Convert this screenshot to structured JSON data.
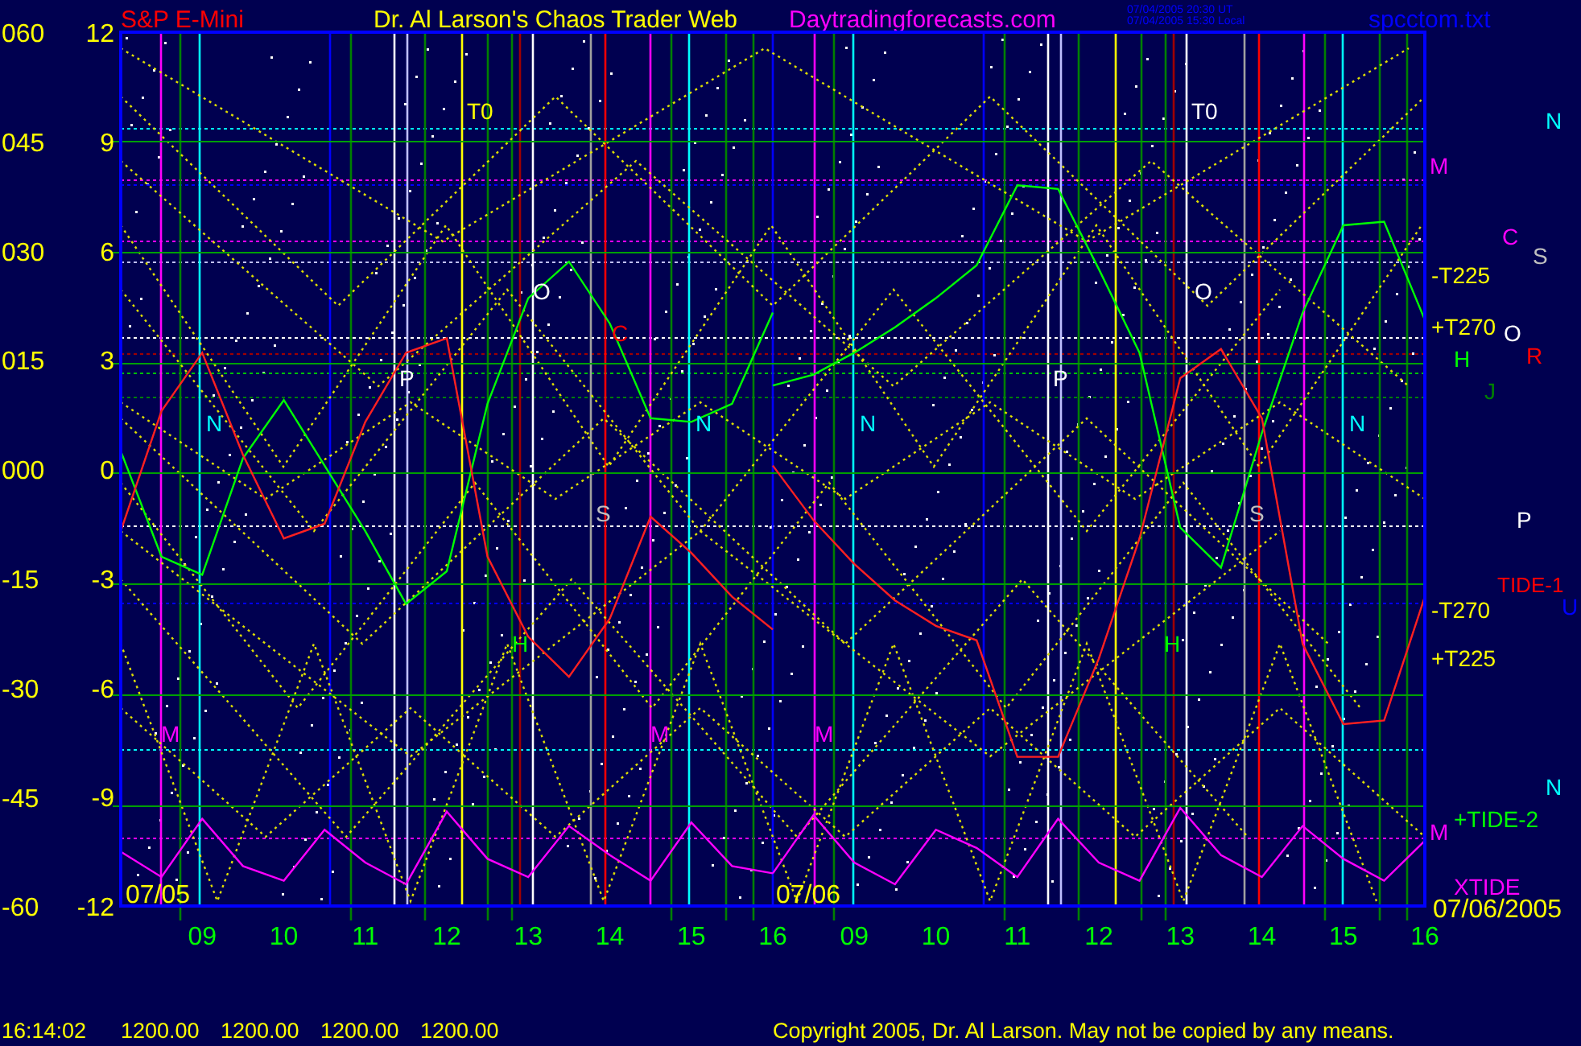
{
  "header": {
    "market": "S&P E-Mini",
    "site_name": "Dr. Al Larson's Chaos Trader Web",
    "url": "Daytradingforecasts.com",
    "timestamps": [
      "07/04/2005 20:30 UT",
      "07/04/2005 15:30 Local"
    ],
    "file": "spcctom.txt"
  },
  "axis_outer": [
    "060",
    "045",
    "030",
    "015",
    "000",
    "-15",
    "-30",
    "-45",
    "-60"
  ],
  "days": [
    {
      "date": "07/05",
      "chart_data": {
        "type": "line",
        "x": [
          8,
          8.5,
          9,
          9.5,
          10,
          10.5,
          11,
          11.5,
          12,
          12.5,
          13,
          13.5,
          14,
          14.5,
          15,
          15.5,
          16
        ],
        "series": [
          {
            "color": "#00ff00",
            "values": [
              0.5,
              -2.4,
              -2.9,
              0.3,
              1.9,
              0.1,
              -1.7,
              -3.7,
              -2.8,
              1.8,
              4.7,
              5.7,
              4.0,
              1.4,
              1.3,
              1.8,
              4.3
            ]
          },
          {
            "color": "#ff2020",
            "values": [
              -1.7,
              1.6,
              3.2,
              0.4,
              -1.9,
              -1.5,
              1.3,
              3.2,
              3.6,
              -2.4,
              -4.6,
              -5.7,
              -4.1,
              -1.3,
              -2.3,
              -3.5,
              -4.4
            ]
          },
          {
            "color": "#ff00ff",
            "values": [
              -10.5,
              -11.2,
              -9.6,
              -10.9,
              -11.3,
              -9.9,
              -10.8,
              -11.4,
              -9.4,
              -10.7,
              -11.2,
              -9.8,
              -10.6,
              -11.3,
              -9.7,
              -10.9,
              -11.1
            ]
          }
        ],
        "xlim": [
          8,
          16
        ],
        "ylim": [
          -12,
          12
        ],
        "xticks": [
          {
            "value": 9,
            "label": "09"
          },
          {
            "value": 10,
            "label": "10"
          },
          {
            "value": 11,
            "label": "11"
          },
          {
            "value": 12,
            "label": "12"
          },
          {
            "value": 13,
            "label": "13"
          },
          {
            "value": 14,
            "label": "14"
          },
          {
            "value": 15,
            "label": "15"
          },
          {
            "value": 16,
            "label": "16"
          }
        ],
        "yticks": [
          12,
          9,
          6,
          3,
          0,
          -3,
          -6,
          -9,
          -12
        ],
        "grid": true
      }
    },
    {
      "date": "07/06",
      "chart_data": {
        "type": "line",
        "x": [
          8,
          8.5,
          9,
          9.5,
          10,
          10.5,
          11,
          11.5,
          12,
          12.5,
          13,
          13.5,
          14,
          14.5,
          15,
          15.5,
          16
        ],
        "series": [
          {
            "color": "#00ff00",
            "values": [
              2.3,
              2.6,
              3.2,
              3.9,
              4.7,
              5.6,
              7.8,
              7.7,
              5.5,
              3.2,
              -1.6,
              -2.7,
              1.0,
              4.3,
              6.7,
              6.8,
              4.1
            ]
          },
          {
            "color": "#ff2020",
            "values": [
              0.1,
              -1.4,
              -2.6,
              -3.6,
              -4.3,
              -4.7,
              -7.9,
              -7.9,
              -5.2,
              -1.9,
              2.5,
              3.3,
              1.4,
              -4.8,
              -7.0,
              -6.9,
              -3.5
            ]
          },
          {
            "color": "#ff00ff",
            "values": [
              -11.1,
              -9.5,
              -10.8,
              -11.4,
              -9.9,
              -10.4,
              -11.2,
              -9.6,
              -10.8,
              -11.3,
              -9.3,
              -10.6,
              -11.2,
              -9.8,
              -10.7,
              -11.3,
              -10.2
            ]
          }
        ],
        "xlim": [
          8,
          16
        ],
        "ylim": [
          -12,
          12
        ],
        "xticks": [
          {
            "value": 9,
            "label": "09"
          },
          {
            "value": 10,
            "label": "10"
          },
          {
            "value": 11,
            "label": "11"
          },
          {
            "value": 12,
            "label": "12"
          },
          {
            "value": 13,
            "label": "13"
          },
          {
            "value": 14,
            "label": "14"
          },
          {
            "value": 15,
            "label": "15"
          },
          {
            "value": 16,
            "label": "16"
          }
        ],
        "grid": true
      }
    }
  ],
  "plot_markers": [
    {
      "text": "T0",
      "color": "#ffff00"
    },
    {
      "text": "T0",
      "color": "#ffffff"
    },
    {
      "text": "O",
      "color": "#ffffff"
    },
    {
      "text": "P",
      "color": "#ffffff"
    },
    {
      "text": "N",
      "color": "#00ffff"
    },
    {
      "text": "C",
      "color": "#ff0000"
    },
    {
      "text": "N",
      "color": "#00ffff"
    },
    {
      "text": "S",
      "color": "#c0c0c0"
    },
    {
      "text": "H",
      "color": "#00ff00"
    },
    {
      "text": "M",
      "color": "#ff00ff"
    },
    {
      "text": "M",
      "color": "#ff00ff"
    },
    {
      "text": "M",
      "color": "#ff00ff"
    },
    {
      "text": "N",
      "color": "#00ffff"
    },
    {
      "text": "P",
      "color": "#ffffff"
    },
    {
      "text": "O",
      "color": "#ffffff"
    },
    {
      "text": "S",
      "color": "#c0c0c0"
    },
    {
      "text": "N",
      "color": "#00ffff"
    },
    {
      "text": "H",
      "color": "#00ff00"
    }
  ],
  "side_labels": [
    {
      "text": "N",
      "color": "#00ffff"
    },
    {
      "text": "M",
      "color": "#ff00ff"
    },
    {
      "text": "C",
      "color": "#ff00ff"
    },
    {
      "text": "S",
      "color": "#c0c0c0"
    },
    {
      "text": "-T225",
      "color": "#ffff00"
    },
    {
      "text": "+T270",
      "color": "#ffff00"
    },
    {
      "text": "O",
      "color": "#ffffff"
    },
    {
      "text": "R",
      "color": "#ff0000"
    },
    {
      "text": "H",
      "color": "#00ff00"
    },
    {
      "text": "J",
      "color": "#008000"
    },
    {
      "text": "P",
      "color": "#ffffff"
    },
    {
      "text": "-T270",
      "color": "#ffff00"
    },
    {
      "text": "TIDE-1",
      "color": "#ff0000"
    },
    {
      "text": "U",
      "color": "#0000ff"
    },
    {
      "text": "+T225",
      "color": "#ffff00"
    },
    {
      "text": "N",
      "color": "#00ffff"
    },
    {
      "text": "M",
      "color": "#ff00ff"
    },
    {
      "text": "+TIDE-2",
      "color": "#00ff00"
    },
    {
      "text": "XTIDE",
      "color": "#ff00ff"
    },
    {
      "text": "07/06/2005",
      "color": "#ffff00"
    }
  ],
  "status_bar": {
    "time": "16:14:02",
    "values": [
      "1200.00",
      "1200.00",
      "1200.00",
      "1200.00"
    ],
    "copyright": "Copyright 2005, Dr. Al Larson. May not be copied by any means."
  }
}
